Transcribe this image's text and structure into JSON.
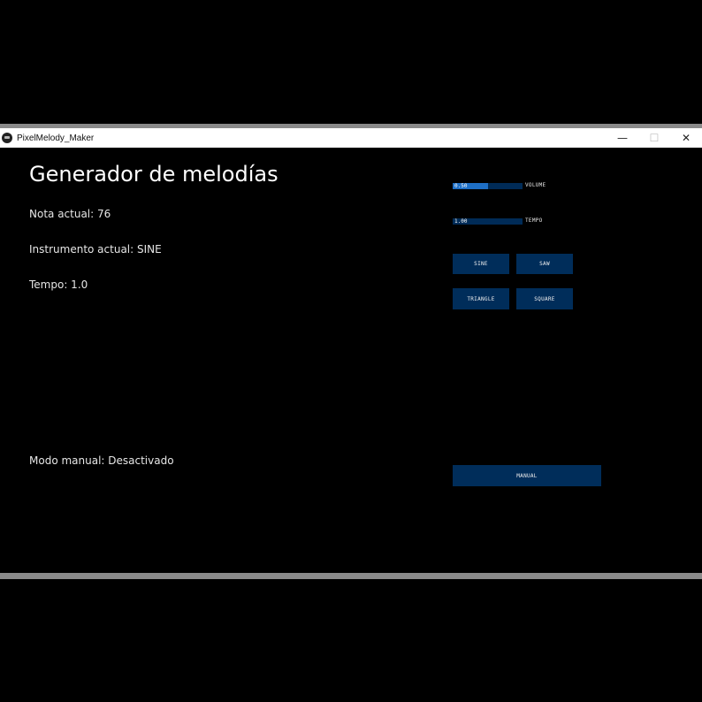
{
  "window": {
    "title": "PixelMelody_Maker",
    "minimize": "—",
    "maximize": "☐",
    "close": "✕"
  },
  "main": {
    "title": "Generador de melodías",
    "current_note": "Nota actual: 76",
    "current_instrument": "Instrumento actual: SINE",
    "tempo": "Tempo: 1.0",
    "manual_mode": "Modo manual: Desactivado"
  },
  "controls": {
    "volume": {
      "value_text": "0.50",
      "label": "VOLUME",
      "fraction": 0.5
    },
    "tempo": {
      "value_text": "1.00",
      "label": "TEMPO",
      "fraction": 0.0
    },
    "buttons": {
      "sine": "SINE",
      "saw": "SAW",
      "triangle": "TRIANGLE",
      "square": "SQUARE",
      "manual": "MANUAL"
    }
  },
  "colors": {
    "button": "#002d5a",
    "slider_track": "#002b57",
    "slider_fill": "#1e6fc6"
  }
}
